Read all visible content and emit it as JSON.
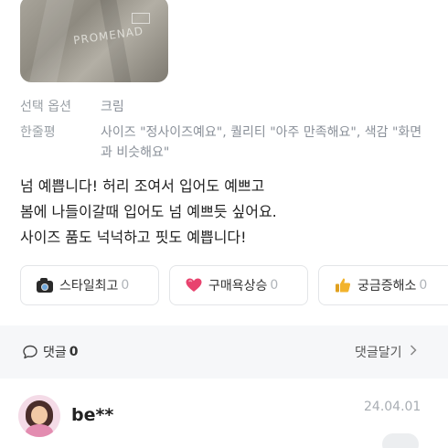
{
  "photo": {
    "print_text": "PROMENAD"
  },
  "options": [
    {
      "label": "선택 옵션",
      "value": "크림"
    },
    {
      "label": "한줄평",
      "value": "사이즈 \"정사이즈예요\", 퀄리티 \"아주 만족해요\", 색감 \"화면과 비슷해요\""
    }
  ],
  "review": {
    "lines": [
      "넘 예쁩니다! 허리 조여서 입어도 예쁘고",
      "봄에 나들이갈때 입어도 넘 예쁘듯 싶어요.",
      "사이즈 품도 넉넉하고 핏도 예쁩니다!"
    ]
  },
  "reactions": [
    {
      "icon": "camera-icon",
      "label": "스타일최고",
      "count": "0"
    },
    {
      "icon": "heart-icon",
      "label": "구매욕상승",
      "count": "0"
    },
    {
      "icon": "thumbs-up-icon",
      "label": "궁금증해소",
      "count": "0"
    }
  ],
  "comments": {
    "label": "댓글",
    "count": "0",
    "write_label": "댓글달기"
  },
  "comment_item": {
    "username": "be**",
    "date": "24.04.01"
  },
  "colors": {
    "heart": "#e8436e",
    "thumb": "#f2b32c",
    "comment_bar_bg": "#f6f7f9"
  }
}
